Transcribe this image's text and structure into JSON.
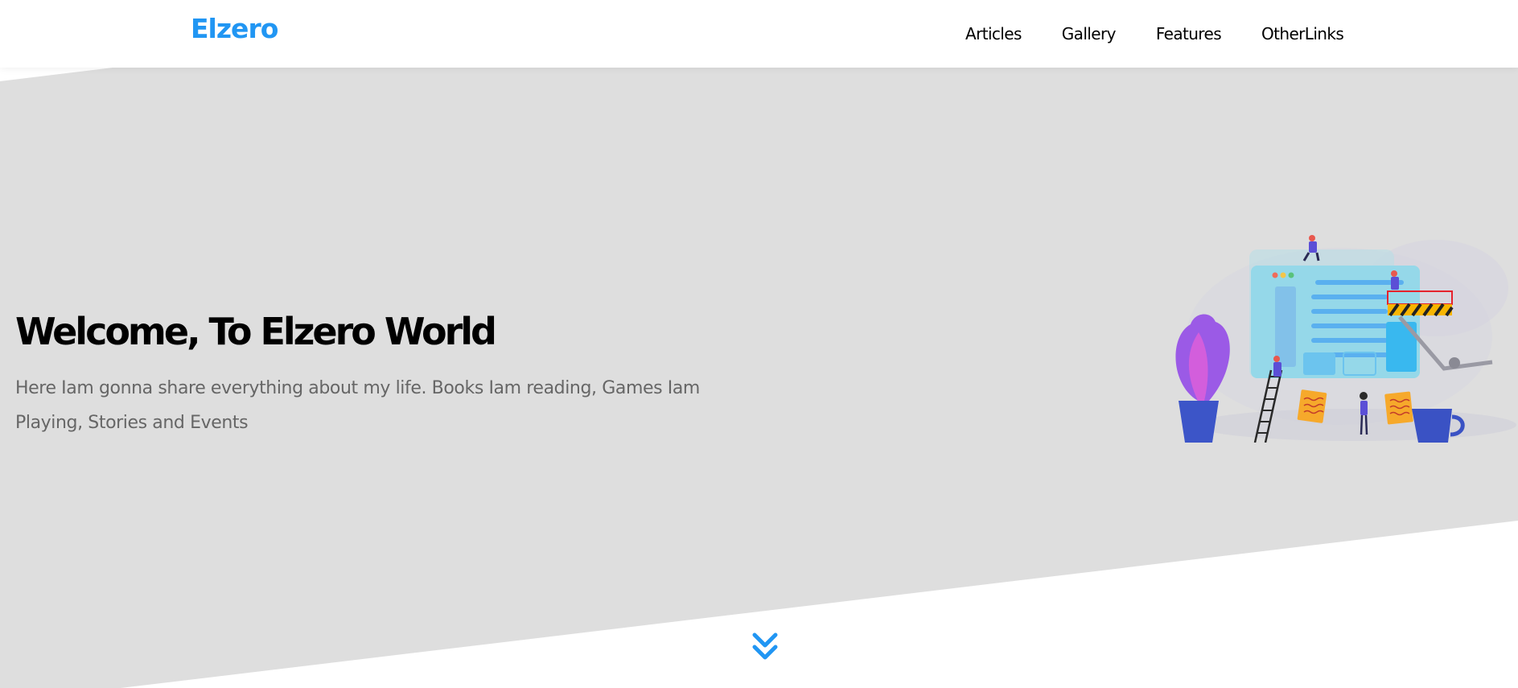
{
  "header": {
    "logo": "Elzero",
    "nav": [
      {
        "label": "Articles"
      },
      {
        "label": "Gallery"
      },
      {
        "label": "Features"
      },
      {
        "label": "OtherLinks"
      }
    ]
  },
  "hero": {
    "title": "Welcome, To Elzero World",
    "description": "Here Iam gonna share everything about my life. Books Iam reading, Games Iam Playing, Stories and Events"
  },
  "icons": {
    "scroll": "double-chevron-down-icon"
  },
  "colors": {
    "accent": "#2196f3",
    "hero_bg": "#dedede",
    "heading": "#000000",
    "body_text": "#666666"
  }
}
